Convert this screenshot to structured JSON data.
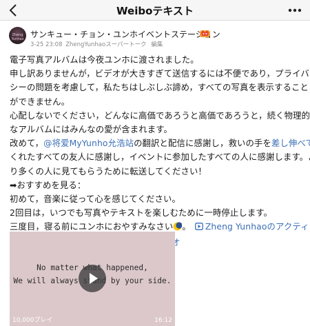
{
  "nav": {
    "title": "Weiboテキスト",
    "back_icon": "chevron-left-icon",
    "more_icon": "more-dots-icon"
  },
  "post": {
    "avatar_text": "Zheng Yunhao",
    "author": "サンキュー・チョン・ユンホイベントステーション",
    "badge_icon": "vip-badge-icon",
    "meta": {
      "timestamp": "3-25 23:08",
      "source": "ZhengYunhaoスーパートーク",
      "edit_label": "編集"
    },
    "lines": {
      "l1": "電子写真アルバムは今夜ユンホに渡されました。",
      "l2": "申し訳ありませんが，ビデオが大きすぎて送信するには不便であり，プライバ",
      "l3": "シーの問題を考慮して，私たちはしぶしぶ諦め，すべての写真を表示すること",
      "l4": "ができません。",
      "l5": "心配しないでください，どんなに高価であろうと高価であろうと，続く物理的",
      "l6": "なアルバムにはみんなの愛が含まれます。",
      "l7a": "改めて，",
      "l7_mention": "@将爱MyYunho允浩站",
      "l7b": "の翻訳と配信に感謝し，救いの手を",
      "l7_link": "差し伸べて",
      "l8": "くれたすべての友人に感謝し，イベントに参加したすべての人に感謝します。よ",
      "l9": "り多くの人に見てもらうために転送してください！",
      "l10": "➡おすすめを見る：",
      "l11": "初めて，音楽に従って心を感じてください。",
      "l12": "2回目は，いつでも写真やテキストを楽しむために一時停止します。",
      "l13a": "三度目，寝る前にユンホにおやすみなさい",
      "l13_emoji": "moon-emoji-icon",
      "l13b": "。",
      "l13_video_icon": "video-link-icon",
      "l13_link": "Zheng Yunhaoのアクティビ",
      "l14_link": "ティステーションのThank・UWeiboビデオ"
    },
    "video": {
      "caption_line1": "No matter what happened,",
      "caption_line2": "We will always stand by your side.",
      "views": "10,000プレイ",
      "duration": "16:12",
      "play_icon": "play-icon",
      "background_color": "#dcc8cb"
    }
  },
  "colors": {
    "link": "#3b6fb6",
    "navbar_bg": "#f6f6f6",
    "meta_gray": "#8a8a8a"
  }
}
